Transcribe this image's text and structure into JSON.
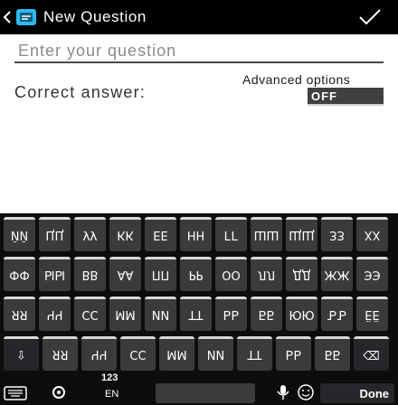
{
  "header": {
    "title": "New Question",
    "colors": {
      "bar": "#000000",
      "accent": "#2eb8f0"
    }
  },
  "form": {
    "question_placeholder": "Enter your question",
    "advanced_label": "Advanced options",
    "correct_answer_label": "Correct answer:",
    "toggle_value": "OFF"
  },
  "keyboard": {
    "row1": [
      "ЙЙ",
      "ЦЦ",
      "УУ",
      "КК",
      "ЕЕ",
      "НН",
      "ГГ",
      "ШШ",
      "ЩЩ",
      "ЗЗ",
      "ХХ"
    ],
    "row2": [
      "ФФ",
      "ЫЫ",
      "ВВ",
      "АА",
      "ПП",
      "РР",
      "ОО",
      "ЛЛ",
      "ДД",
      "ЖЖ",
      "ЭЭ"
    ],
    "row3": [
      "ЯЯ",
      "ЧЧ",
      "СС",
      "ММ",
      "ИИ",
      "ТТ",
      "ЬЬ",
      "ББ",
      "ЮЮ",
      "ЪЪ",
      "ЁЁ"
    ],
    "row4": [
      "⇧",
      "ЯЯ",
      "ЧЧ",
      "СС",
      "ММ",
      "ИИ",
      "ТТ",
      "ЬЬ",
      "ББ",
      "⌫"
    ],
    "bottom": {
      "num_label": "123",
      "lang_label": "EN",
      "done_label": "Done"
    },
    "icons": [
      "keyboard-icon",
      "settings-icon",
      "mic-icon",
      "emoji-icon"
    ]
  }
}
